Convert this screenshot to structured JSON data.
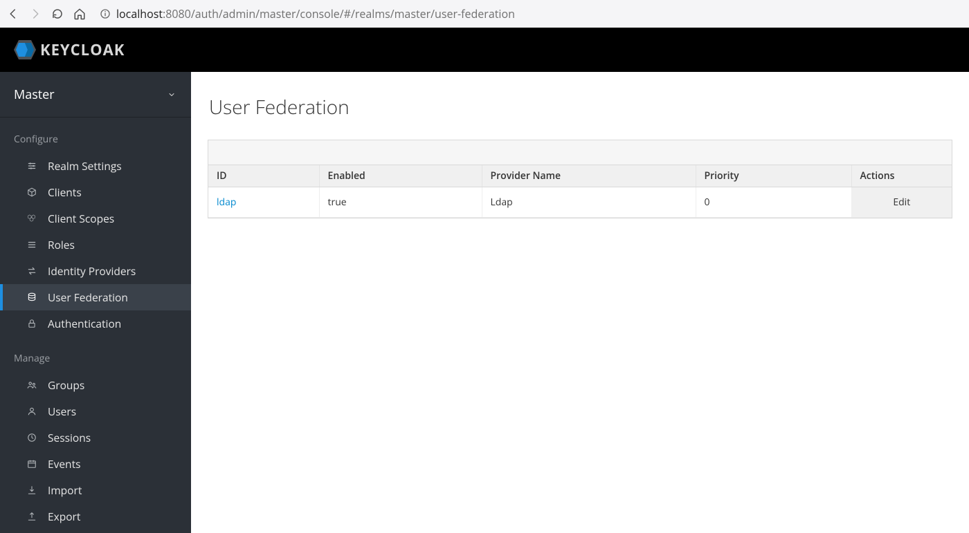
{
  "browser": {
    "url_host": "localhost",
    "url_path": ":8080/auth/admin/master/console/#/realms/master/user-federation"
  },
  "brand": "KEYCLOAK",
  "realm": {
    "name": "Master"
  },
  "sidebar": {
    "section_configure": "Configure",
    "section_manage": "Manage",
    "configure": [
      {
        "key": "realm-settings",
        "label": "Realm Settings"
      },
      {
        "key": "clients",
        "label": "Clients"
      },
      {
        "key": "client-scopes",
        "label": "Client Scopes"
      },
      {
        "key": "roles",
        "label": "Roles"
      },
      {
        "key": "identity-providers",
        "label": "Identity Providers"
      },
      {
        "key": "user-federation",
        "label": "User Federation"
      },
      {
        "key": "authentication",
        "label": "Authentication"
      }
    ],
    "manage": [
      {
        "key": "groups",
        "label": "Groups"
      },
      {
        "key": "users",
        "label": "Users"
      },
      {
        "key": "sessions",
        "label": "Sessions"
      },
      {
        "key": "events",
        "label": "Events"
      },
      {
        "key": "import",
        "label": "Import"
      },
      {
        "key": "export",
        "label": "Export"
      }
    ]
  },
  "page": {
    "title": "User Federation"
  },
  "table": {
    "headers": {
      "id": "ID",
      "enabled": "Enabled",
      "provider": "Provider Name",
      "priority": "Priority",
      "actions": "Actions"
    },
    "rows": [
      {
        "id": "ldap",
        "enabled": "true",
        "provider": "Ldap",
        "priority": "0",
        "action": "Edit"
      }
    ]
  }
}
